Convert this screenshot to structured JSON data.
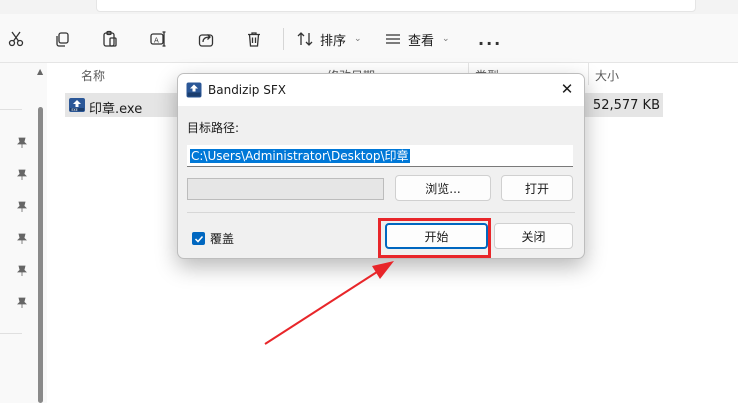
{
  "toolbar": {
    "items": [
      {
        "icon": "cut-icon"
      },
      {
        "icon": "copy-icon"
      },
      {
        "icon": "paste-icon"
      },
      {
        "icon": "rename-icon"
      },
      {
        "icon": "share-icon"
      },
      {
        "icon": "delete-icon"
      }
    ],
    "sort_label": "排序",
    "view_label": "查看",
    "more_label": "..."
  },
  "filelist": {
    "columns": [
      "名称",
      "修改日期",
      "类型",
      "大小"
    ],
    "rows": [
      {
        "name": "印章.exe",
        "size": "52,577 KB",
        "icon": "exe-file-icon"
      }
    ]
  },
  "dialog": {
    "title": "Bandizip SFX",
    "path_label": "目标路径:",
    "path_value": "C:\\Users\\Administrator\\Desktop\\印章",
    "progress": 0,
    "browse_label": "浏览...",
    "open_label": "打开",
    "overwrite_label": "覆盖",
    "overwrite_checked": true,
    "start_label": "开始",
    "close_label": "关闭"
  },
  "colors": {
    "accent": "#0067c0",
    "annotation": "#e8262a",
    "selection": "#0078d7"
  }
}
